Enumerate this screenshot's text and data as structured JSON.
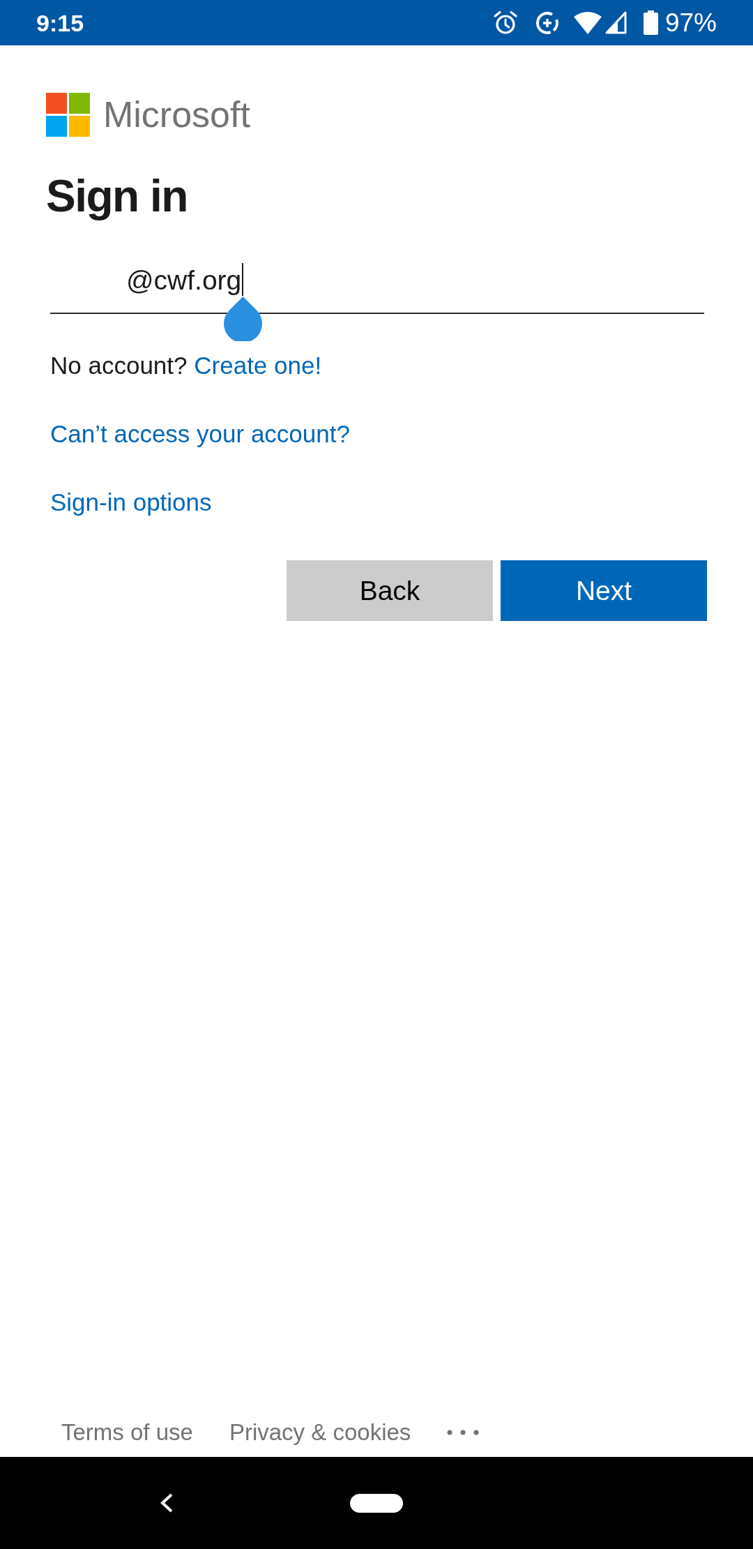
{
  "status_bar": {
    "time": "9:15",
    "battery_percent": "97%"
  },
  "brand": {
    "name": "Microsoft"
  },
  "heading": "Sign in",
  "email_field": {
    "value": "@cwf.org",
    "focused": true
  },
  "no_account": {
    "text": "No account?",
    "link": "Create one!"
  },
  "links": [
    "Can’t access your account?",
    "Sign-in options"
  ],
  "buttons": [
    {
      "label": "Back",
      "kind": "secondary"
    },
    {
      "label": "Next",
      "kind": "primary"
    }
  ],
  "footer": {
    "links": [
      "Terms of use",
      "Privacy & cookies"
    ]
  }
}
